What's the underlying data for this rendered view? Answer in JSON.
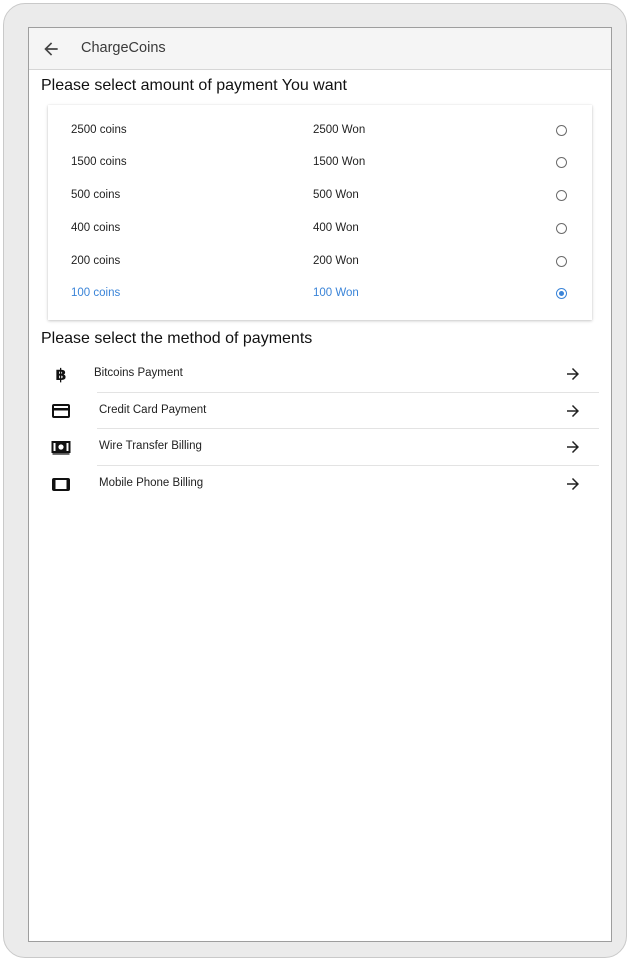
{
  "appbar": {
    "title": "ChargeCoins",
    "back_icon": "arrow-back-icon"
  },
  "amount_section": {
    "title": "Please select amount of payment You want",
    "options": [
      {
        "coins": "2500 coins",
        "price": "2500 Won",
        "selected": false
      },
      {
        "coins": "1500 coins",
        "price": "1500 Won",
        "selected": false
      },
      {
        "coins": "500 coins",
        "price": "500 Won",
        "selected": false
      },
      {
        "coins": "400 coins",
        "price": "400 Won",
        "selected": false
      },
      {
        "coins": "200 coins",
        "price": "200 Won",
        "selected": false
      },
      {
        "coins": "100 coins",
        "price": "100 Won",
        "selected": true
      }
    ]
  },
  "method_section": {
    "title": "Please select the method of payments",
    "methods": [
      {
        "label": "Bitcoins Payment",
        "icon": "bitcoin-icon"
      },
      {
        "label": "Credit Card Payment",
        "icon": "credit-card-icon"
      },
      {
        "label": "Wire Transfer Billing",
        "icon": "money-icon"
      },
      {
        "label": "Mobile Phone Billing",
        "icon": "mobile-phone-icon"
      }
    ]
  },
  "colors": {
    "accent": "#3a84d8",
    "text": "#222222",
    "appbar_bg": "#f5f5f5"
  }
}
